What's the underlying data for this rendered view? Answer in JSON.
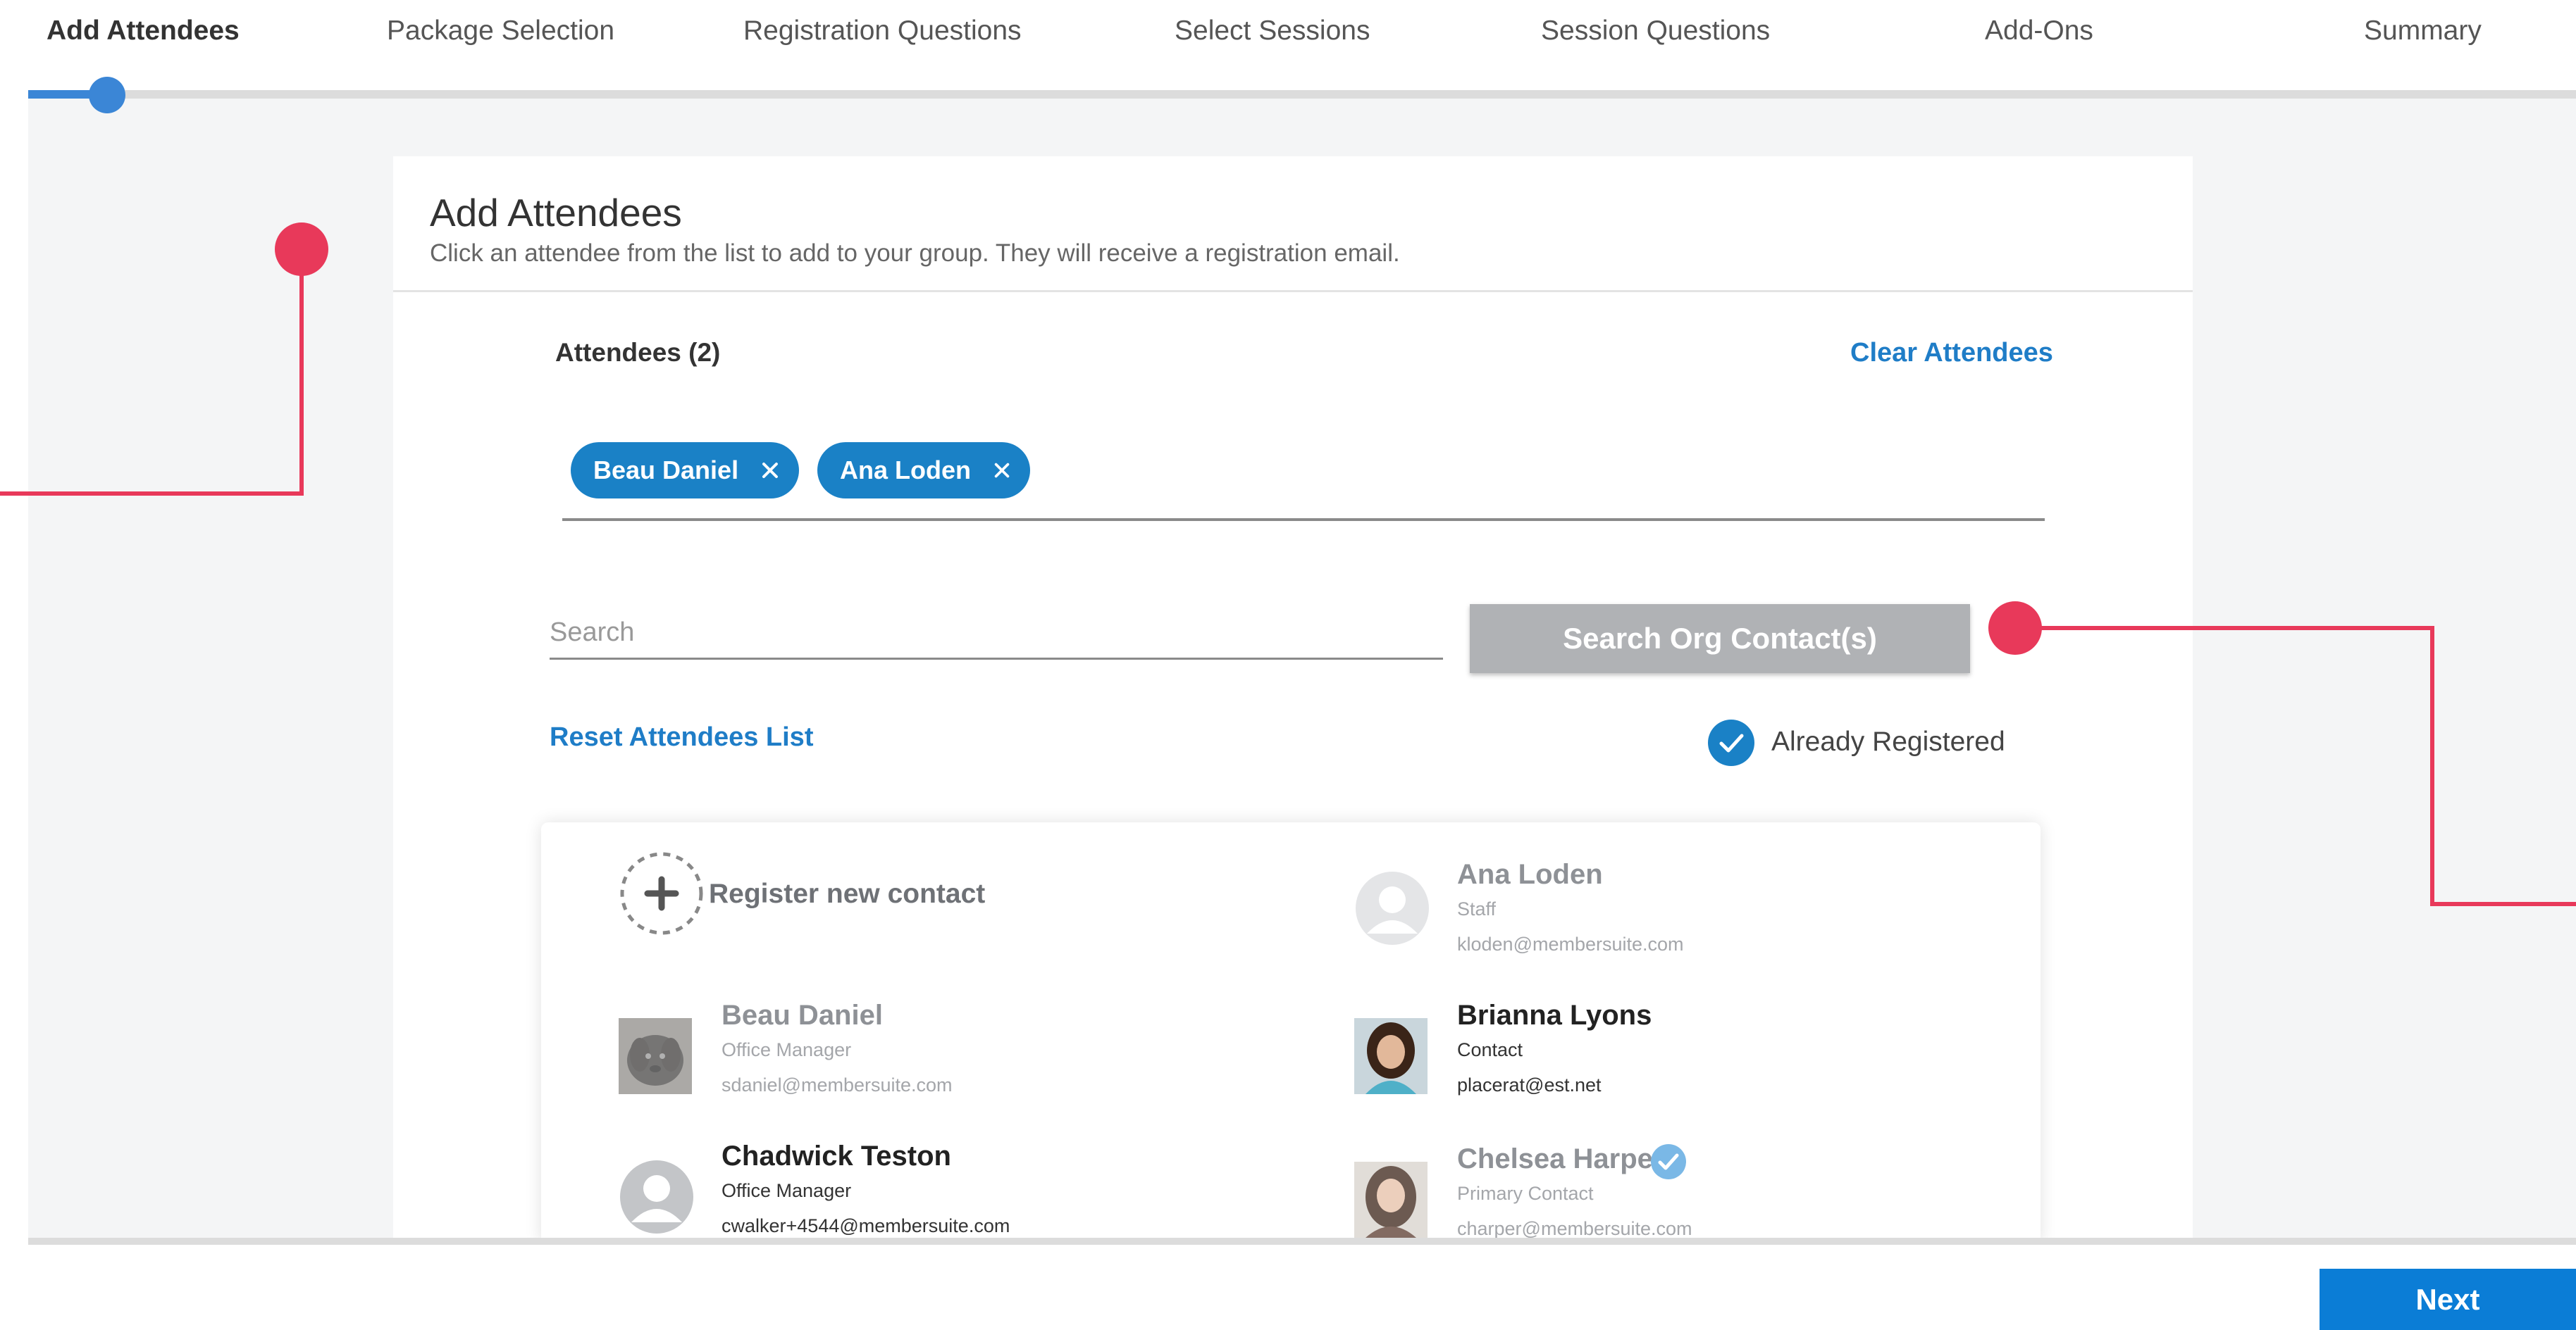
{
  "steps": [
    {
      "label": "Add Attendees",
      "active": true
    },
    {
      "label": "Package Selection",
      "active": false
    },
    {
      "label": "Registration Questions",
      "active": false
    },
    {
      "label": "Select Sessions",
      "active": false
    },
    {
      "label": "Session Questions",
      "active": false
    },
    {
      "label": "Add-Ons",
      "active": false
    },
    {
      "label": "Summary",
      "active": false
    }
  ],
  "progress": {
    "current_step": 1,
    "total_steps": 7
  },
  "card": {
    "title": "Add Attendees",
    "subtitle": "Click an attendee from the list to add to your group. They will receive a registration email."
  },
  "attendees": {
    "label": "Attendees (2)",
    "clear_label": "Clear Attendees",
    "chips": [
      {
        "name": "Beau Daniel"
      },
      {
        "name": "Ana Loden"
      }
    ]
  },
  "search": {
    "placeholder": "Search",
    "value": "",
    "button_label": "Search Org Contact(s)"
  },
  "reset_label": "Reset Attendees List",
  "already_registered": {
    "label": "Already Registered",
    "checked": true
  },
  "contacts": {
    "register_new_label": "Register new contact",
    "items": [
      {
        "name": "Ana Loden",
        "role": "Staff",
        "email": "kloden@membersuite.com",
        "image": "avatar-placeholder",
        "state": "dimmed",
        "verified": false
      },
      {
        "name": "Beau Daniel",
        "role": "Office Manager",
        "email": "sdaniel@membersuite.com",
        "image": "dog-photo",
        "state": "dimmed",
        "verified": false
      },
      {
        "name": "Brianna Lyons",
        "role": "Contact",
        "email": "placerat@est.net",
        "image": "woman-photo",
        "state": "normal",
        "verified": false
      },
      {
        "name": "Chadwick Teston",
        "role": "Office Manager",
        "email": "cwalker+4544@membersuite.com",
        "image": "avatar-placeholder",
        "state": "normal",
        "verified": false
      },
      {
        "name": "Chelsea Harper",
        "role": "Primary Contact",
        "email": "charper@membersuite.com",
        "image": "woman-photo",
        "state": "dimmed",
        "verified": true
      }
    ]
  },
  "footer": {
    "next_label": "Next"
  },
  "colors": {
    "accent": "#1a81c6",
    "progress": "#3b86d6",
    "callout": "#e8395a",
    "button_disabled": "#b0b2b5",
    "next": "#0b7dd6"
  },
  "icons": [
    "close-icon",
    "check-icon",
    "plus-icon",
    "avatar-icon",
    "verified-icon"
  ]
}
